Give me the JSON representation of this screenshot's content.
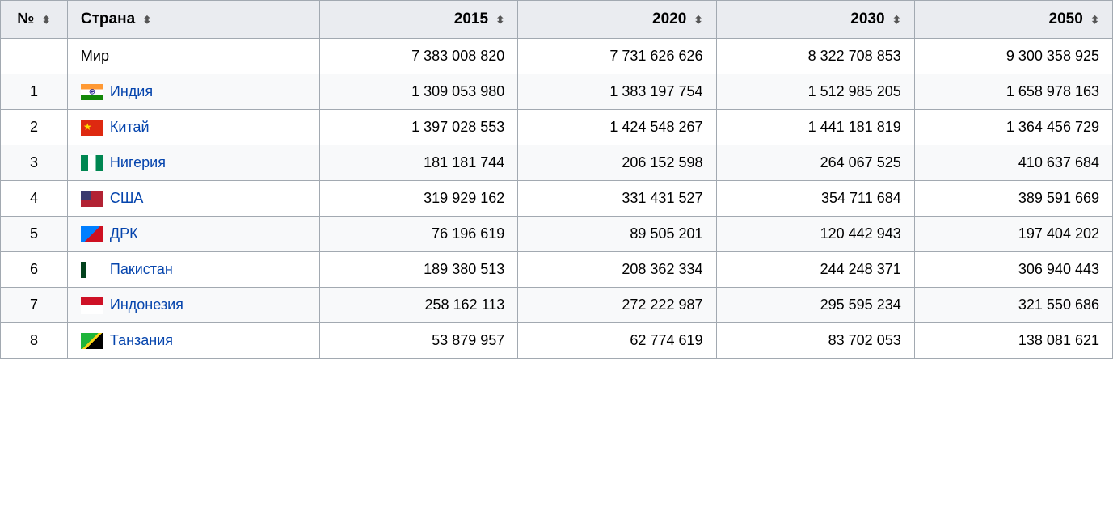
{
  "table": {
    "headers": [
      {
        "key": "num",
        "label": "№",
        "sortable": true
      },
      {
        "key": "country",
        "label": "Страна",
        "sortable": true
      },
      {
        "key": "y2015",
        "label": "2015",
        "sortable": true
      },
      {
        "key": "y2020",
        "label": "2020",
        "sortable": true
      },
      {
        "key": "y2030",
        "label": "2030",
        "sortable": true
      },
      {
        "key": "y2050",
        "label": "2050",
        "sortable": true
      }
    ],
    "world_row": {
      "num": "",
      "country": "Мир",
      "flag": null,
      "y2015": "7 383 008 820",
      "y2020": "7 731 626 626",
      "y2030": "8 322 708 853",
      "y2050": "9 300 358 925"
    },
    "rows": [
      {
        "num": "1",
        "country": "Индия",
        "flag_class": "flag-india",
        "y2015": "1 309 053 980",
        "y2020": "1 383 197 754",
        "y2030": "1 512 985 205",
        "y2050": "1 658 978 163"
      },
      {
        "num": "2",
        "country": "Китай",
        "flag_class": "flag-china",
        "y2015": "1 397 028 553",
        "y2020": "1 424 548 267",
        "y2030": "1 441 181 819",
        "y2050": "1 364 456 729"
      },
      {
        "num": "3",
        "country": "Нигерия",
        "flag_class": "flag-nigeria",
        "y2015": "181 181 744",
        "y2020": "206 152 598",
        "y2030": "264 067 525",
        "y2050": "410 637 684"
      },
      {
        "num": "4",
        "country": "США",
        "flag_class": "flag-usa",
        "y2015": "319 929 162",
        "y2020": "331 431 527",
        "y2030": "354 711 684",
        "y2050": "389 591 669"
      },
      {
        "num": "5",
        "country": "ДРК",
        "flag_class": "flag-drc",
        "y2015": "76 196 619",
        "y2020": "89 505 201",
        "y2030": "120 442 943",
        "y2050": "197 404 202"
      },
      {
        "num": "6",
        "country": "Пакистан",
        "flag_class": "flag-pakistan",
        "y2015": "189 380 513",
        "y2020": "208 362 334",
        "y2030": "244 248 371",
        "y2050": "306 940 443"
      },
      {
        "num": "7",
        "country": "Индонезия",
        "flag_class": "flag-indonesia",
        "y2015": "258 162 113",
        "y2020": "272 222 987",
        "y2030": "295 595 234",
        "y2050": "321 550 686"
      },
      {
        "num": "8",
        "country": "Танзания",
        "flag_class": "flag-tanzania",
        "y2015": "53 879 957",
        "y2020": "62 774 619",
        "y2030": "83 702 053",
        "y2050": "138 081 621"
      }
    ]
  }
}
